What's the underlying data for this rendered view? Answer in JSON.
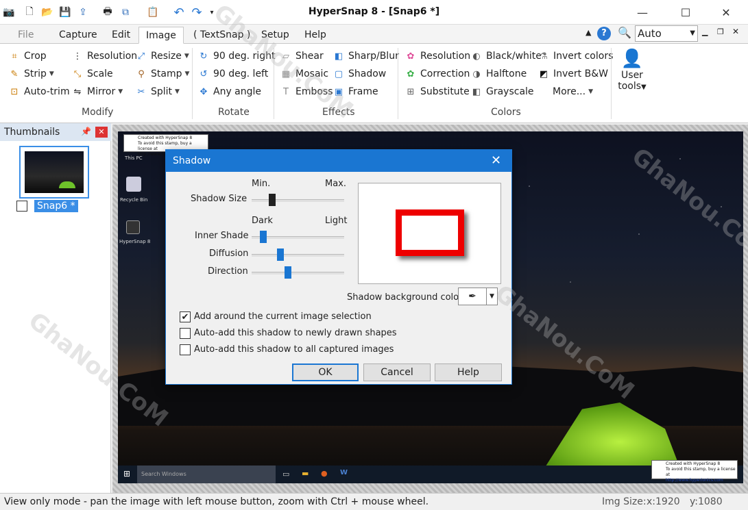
{
  "window": {
    "title": "HyperSnap 8 - [Snap6 *]"
  },
  "quick_access": [
    "camera-icon",
    "new-icon",
    "open-icon",
    "save-icon",
    "upload-icon",
    "print-icon",
    "copy-icon",
    "clipboard-icon",
    "undo-icon",
    "redo-icon"
  ],
  "menu": {
    "tabs": [
      "File",
      "Capture",
      "Edit",
      "Image",
      "( TextSnap )",
      "Setup",
      "Help"
    ],
    "active": "Image",
    "zoom": "Auto"
  },
  "ribbon": {
    "modify": {
      "label": "Modify",
      "items": [
        "Crop",
        "Resolution",
        "Resize",
        "Strip",
        "Scale",
        "Stamp",
        "Auto-trim",
        "Mirror",
        "Split"
      ]
    },
    "rotate": {
      "label": "Rotate",
      "items": [
        "90 deg. right",
        "90 deg. left",
        "Any angle"
      ]
    },
    "effects": {
      "label": "Effects",
      "items": [
        "Shear",
        "Sharp/Blur",
        "Mosaic",
        "Shadow",
        "Emboss",
        "Frame"
      ]
    },
    "colors": {
      "label": "Colors",
      "items": [
        "Resolution",
        "Black/white",
        "Invert colors",
        "Correction",
        "Halftone",
        "Invert B&W",
        "Substitute",
        "Grayscale",
        "More..."
      ]
    },
    "user_tools": {
      "line1": "User",
      "line2": "tools"
    }
  },
  "thumbnails": {
    "title": "Thumbnails",
    "item": "Snap6 *"
  },
  "desktop": {
    "stamp_line1": "Created with HyperSnap 8",
    "stamp_line2": "To avoid this stamp, buy a license at",
    "stamp_line3": "http://www.hyperionics.com",
    "stamp_short": "http://www.hy",
    "icons": [
      "This PC",
      "Recycle Bin",
      "HyperSnap 8"
    ],
    "search": "Search Windows"
  },
  "dialog": {
    "title": "Shadow",
    "min": "Min.",
    "max": "Max.",
    "dark": "Dark",
    "light": "Light",
    "shadow_size": "Shadow Size",
    "inner_shade": "Inner Shade",
    "diffusion": "Diffusion",
    "direction": "Direction",
    "bg_color": "Shadow background color:",
    "cb1": "Add around the current image selection",
    "cb2": "Auto-add this shadow to newly drawn shapes",
    "cb3": "Auto-add this shadow to all captured images",
    "ok": "OK",
    "cancel": "Cancel",
    "help": "Help"
  },
  "status": {
    "text": "View only mode - pan the image with left mouse button, zoom with Ctrl + mouse wheel.",
    "img_size": "Img Size:",
    "x": "x:1920",
    "y": "y:1080"
  },
  "watermark": "GhaNou.CoM"
}
